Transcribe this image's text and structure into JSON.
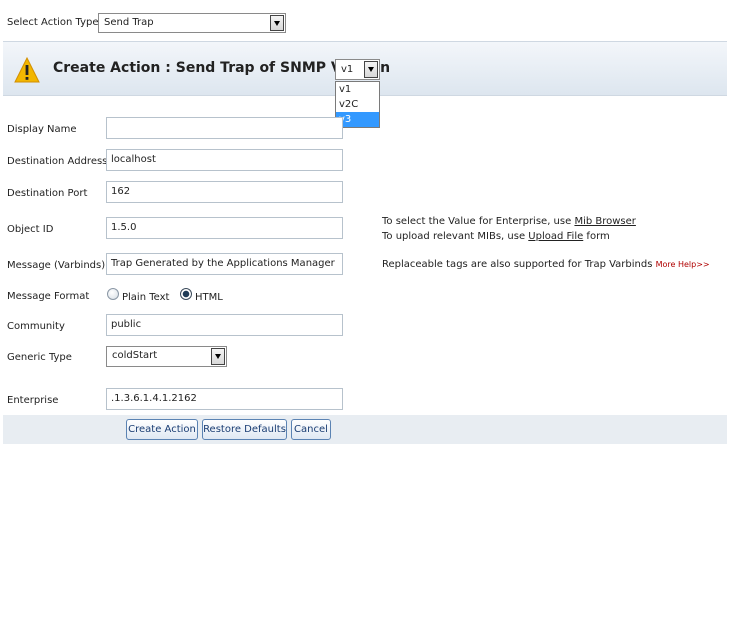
{
  "top": {
    "action_type_label": "Select Action Type",
    "action_type_value": "Send Trap"
  },
  "header": {
    "title": "Create Action : Send Trap of SNMP Version",
    "version_selected": "v1",
    "version_options": [
      "v1",
      "v2C",
      "v3"
    ],
    "highlighted_option": "v3"
  },
  "form": {
    "display_name_label": "Display Name",
    "display_name_value": "",
    "dest_address_label": "Destination Address",
    "dest_address_value": "localhost",
    "dest_port_label": "Destination Port",
    "dest_port_value": "162",
    "object_id_label": "Object ID",
    "object_id_value": "1.5.0",
    "message_label": "Message (Varbinds)",
    "message_value": "Trap Generated by the Applications Manager",
    "format_label": "Message Format",
    "format_plain": "Plain Text",
    "format_html": "HTML",
    "format_selected": "HTML",
    "community_label": "Community",
    "community_value": "public",
    "generic_type_label": "Generic Type",
    "generic_type_value": "coldStart",
    "enterprise_label": "Enterprise",
    "enterprise_value": ".1.3.6.1.4.1.2162"
  },
  "hints": {
    "line1_prefix": "To select the Value for Enterprise, use ",
    "mib_browser": "Mib Browser",
    "line2_prefix": "To upload relevant MIBs, use ",
    "upload_file": "Upload File",
    "line2_suffix": " form",
    "varbinds": "Replaceable tags are also supported for Trap Varbinds",
    "more_help": "More Help>>"
  },
  "buttons": {
    "create": "Create Action",
    "restore": "Restore Defaults",
    "cancel": "Cancel"
  },
  "colors": {
    "header_band": "#dde6ef",
    "footer_band": "#e8edf2",
    "button_text": "#1a3d73",
    "highlight": "#3399ff",
    "more_help": "#b00000"
  },
  "icons": {
    "header": "warning-icon"
  }
}
